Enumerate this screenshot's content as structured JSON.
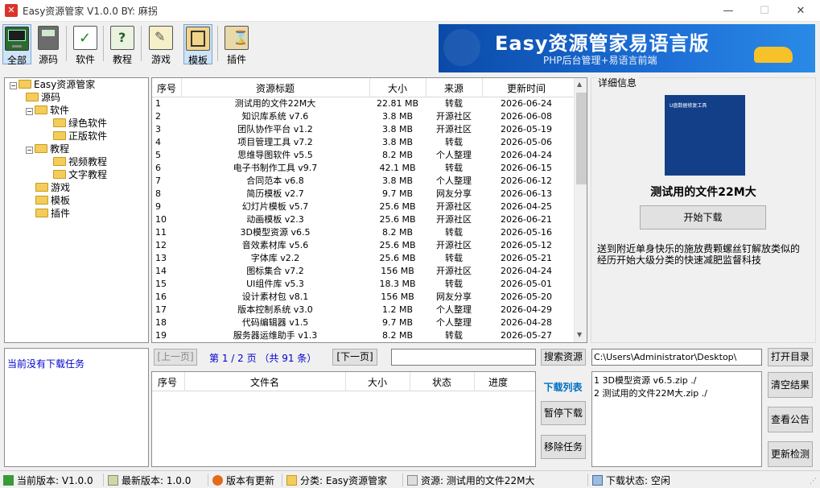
{
  "window": {
    "title": "Easy资源管家 V1.0.0  BY: 麻拐",
    "icon": "app-logo-icon"
  },
  "toolbar": {
    "buttons": [
      {
        "label": "全部",
        "icon": "computer-icon",
        "active": true
      },
      {
        "label": "源码",
        "icon": "phone-icon"
      },
      {
        "label": "软件",
        "icon": "checkbox-icon"
      },
      {
        "label": "教程",
        "icon": "book-question-icon"
      },
      {
        "label": "游戏",
        "icon": "notepad-pencil-icon"
      },
      {
        "label": "模板",
        "icon": "edit-frame-icon"
      },
      {
        "label": "插件",
        "icon": "hourglass-icon"
      }
    ]
  },
  "banner": {
    "title": "Easy资源管家易语言版",
    "subtitle": "PHP后台管理+易语言前端"
  },
  "tree": {
    "root": "Easy资源管家",
    "items": [
      {
        "label": "源码",
        "level": 1
      },
      {
        "label": "软件",
        "level": 1
      },
      {
        "label": "绿色软件",
        "level": 2
      },
      {
        "label": "正版软件",
        "level": 2
      },
      {
        "label": "教程",
        "level": 1
      },
      {
        "label": "视频教程",
        "level": 2
      },
      {
        "label": "文字教程",
        "level": 2
      },
      {
        "label": "游戏",
        "level": 1
      },
      {
        "label": "模板",
        "level": 1
      },
      {
        "label": "插件",
        "level": 1
      }
    ]
  },
  "list": {
    "headers": [
      "序号",
      "资源标题",
      "大小",
      "来源",
      "更新时间"
    ],
    "rows": [
      [
        "1",
        "测试用的文件22M大",
        "22.81 MB",
        "转载",
        "2026-06-24"
      ],
      [
        "2",
        "知识库系统 v7.6",
        "3.8 MB",
        "开源社区",
        "2026-06-08"
      ],
      [
        "3",
        "团队协作平台 v1.2",
        "3.8 MB",
        "开源社区",
        "2026-05-19"
      ],
      [
        "4",
        "项目管理工具 v7.2",
        "3.8 MB",
        "转载",
        "2026-05-06"
      ],
      [
        "5",
        "思维导图软件 v5.5",
        "8.2 MB",
        "个人整理",
        "2026-04-24"
      ],
      [
        "6",
        "电子书制作工具 v9.7",
        "42.1 MB",
        "转载",
        "2026-06-15"
      ],
      [
        "7",
        "合同范本 v6.8",
        "3.8 MB",
        "个人整理",
        "2026-06-12"
      ],
      [
        "8",
        "简历模板 v2.7",
        "9.7 MB",
        "网友分享",
        "2026-06-13"
      ],
      [
        "9",
        "幻灯片模板 v5.7",
        "25.6 MB",
        "开源社区",
        "2026-04-25"
      ],
      [
        "10",
        "动画模板 v2.3",
        "25.6 MB",
        "开源社区",
        "2026-06-21"
      ],
      [
        "11",
        "3D模型资源 v6.5",
        "8.2 MB",
        "转载",
        "2026-05-16"
      ],
      [
        "12",
        "音效素材库 v5.6",
        "25.6 MB",
        "开源社区",
        "2026-05-12"
      ],
      [
        "13",
        "字体库 v2.2",
        "25.6 MB",
        "转载",
        "2026-05-21"
      ],
      [
        "14",
        "图标集合 v7.2",
        "156 MB",
        "开源社区",
        "2026-04-24"
      ],
      [
        "15",
        "UI组件库 v5.3",
        "18.3 MB",
        "转载",
        "2026-05-01"
      ],
      [
        "16",
        "设计素材包 v8.1",
        "156 MB",
        "网友分享",
        "2026-05-20"
      ],
      [
        "17",
        "版本控制系统 v3.0",
        "1.2 MB",
        "个人整理",
        "2026-04-29"
      ],
      [
        "18",
        "代码编辑器 v1.5",
        "9.7 MB",
        "个人整理",
        "2026-04-28"
      ],
      [
        "19",
        "服务器运维助手 v1.3",
        "8.2 MB",
        "转载",
        "2026-05-27"
      ]
    ]
  },
  "detail": {
    "group_title": "详细信息",
    "cover_text": "U盘数据修复工具",
    "name": "测试用的文件22M大",
    "download_button": "开始下载",
    "description": "送到附近单身快乐的施放费颗螺丝钉解放类似的经历开始大级分类的快速减肥监督科技"
  },
  "status_panel": {
    "text": "当前没有下载任务"
  },
  "pager": {
    "prev": "[上一页]",
    "info": "第 1 / 2 页 （共 91 条）",
    "next": "[下一页]",
    "search_value": "",
    "search_button": "搜索资源"
  },
  "path_field": {
    "value": "C:\\Users\\Administrator\\Desktop\\"
  },
  "open_dir_button": "打开目录",
  "downloads": {
    "headers": [
      "序号",
      "文件名",
      "大小",
      "状态",
      "进度"
    ],
    "list_title": "下载列表",
    "pause_button": "暂停下载",
    "remove_button": "移除任务"
  },
  "results": {
    "lines": [
      "1 3D模型资源 v6.5.zip ./",
      "2 测试用的文件22M大.zip ./"
    ],
    "clear_button": "清空结果",
    "notice_button": "查看公告",
    "update_button": "更新检测"
  },
  "statusbar": {
    "current_version": "当前版本: V1.0.0",
    "latest_version": "最新版本: 1.0.0",
    "update_status": "版本有更新",
    "category": "分类: Easy资源管家",
    "resource": "资源: 测试用的文件22M大",
    "download_status": "下载状态: 空闲"
  },
  "colors": {
    "accent_blue": "#0000cc",
    "banner_blue": "#1d6fd6",
    "list_title": "#0070c0"
  }
}
